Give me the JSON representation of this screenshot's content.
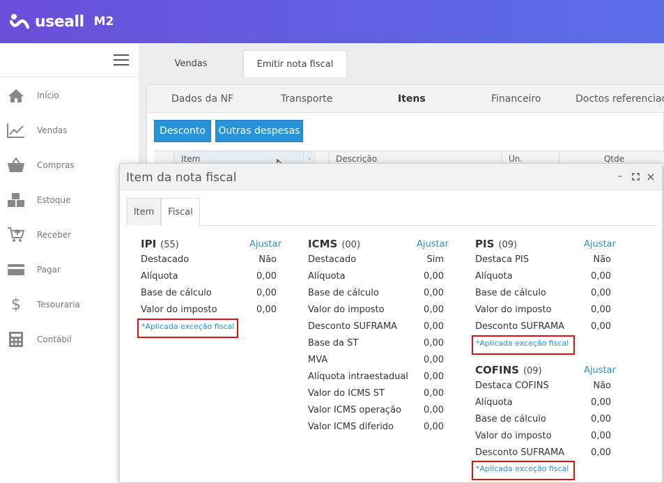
{
  "app": {
    "brand": "useall",
    "version": "M2"
  },
  "sidebar": {
    "items": [
      {
        "label": "Início",
        "icon": "home-icon"
      },
      {
        "label": "Vendas",
        "icon": "chart-line-icon"
      },
      {
        "label": "Compras",
        "icon": "basket-icon"
      },
      {
        "label": "Estoque",
        "icon": "boxes-icon"
      },
      {
        "label": "Receber",
        "icon": "cart-plus-icon"
      },
      {
        "label": "Pagar",
        "icon": "credit-card-icon"
      },
      {
        "label": "Tesouraria",
        "icon": "dollar-icon"
      },
      {
        "label": "Contábil",
        "icon": "calculator-icon"
      }
    ]
  },
  "top_tabs": [
    "Vendas",
    "Emitir nota fiscal"
  ],
  "sub_tabs": [
    "Dados da NF",
    "Transporte",
    "Itens",
    "Financeiro",
    "Doctos referenciados"
  ],
  "buttons": {
    "desconto": "Desconto",
    "outras": "Outras despesas"
  },
  "grid_headers": [
    "Item",
    "Descrição",
    "Un.",
    "Qtde"
  ],
  "modal": {
    "title": "Item da nota fiscal",
    "tabs": [
      "Item",
      "Fiscal"
    ],
    "ajustar": "Ajustar",
    "exception_text": "*Aplicada exceção fiscal",
    "ipi": {
      "title": "IPI",
      "code": "(55)",
      "rows": [
        {
          "label": "Destacado",
          "value": "Não"
        },
        {
          "label": "Alíquota",
          "value": "0,00"
        },
        {
          "label": "Base de cálculo",
          "value": "0,00"
        },
        {
          "label": "Valor do imposto",
          "value": "0,00"
        }
      ]
    },
    "icms": {
      "title": "ICMS",
      "code": "(00)",
      "rows": [
        {
          "label": "Destacado",
          "value": "Sim"
        },
        {
          "label": "Alíquota",
          "value": "0,00"
        },
        {
          "label": "Base de cálculo",
          "value": "0,00"
        },
        {
          "label": "Valor do imposto",
          "value": "0,00"
        },
        {
          "label": "Desconto SUFRAMA",
          "value": "0,00"
        },
        {
          "label": "Base da ST",
          "value": "0,00"
        },
        {
          "label": "MVA",
          "value": "0,00"
        },
        {
          "label": "Alíquota intraestadual",
          "value": "0,00"
        },
        {
          "label": "Valor do ICMS ST",
          "value": "0,00"
        },
        {
          "label": "Valor ICMS operação",
          "value": "0,00"
        },
        {
          "label": "Valor ICMS diferido",
          "value": "0,00"
        }
      ]
    },
    "pis": {
      "title": "PIS",
      "code": "(09)",
      "rows": [
        {
          "label": "Destaca PIS",
          "value": "Não"
        },
        {
          "label": "Alíquota",
          "value": "0,00"
        },
        {
          "label": "Base de cálculo",
          "value": "0,00"
        },
        {
          "label": "Valor do imposto",
          "value": "0,00"
        },
        {
          "label": "Desconto SUFRAMA",
          "value": "0,00"
        }
      ]
    },
    "cofins": {
      "title": "COFINS",
      "code": "(09)",
      "rows": [
        {
          "label": "Destaca COFINS",
          "value": "Não"
        },
        {
          "label": "Alíquota",
          "value": "0,00"
        },
        {
          "label": "Base de cálculo",
          "value": "0,00"
        },
        {
          "label": "Valor do imposto",
          "value": "0,00"
        },
        {
          "label": "Desconto SUFRAMA",
          "value": "0,00"
        }
      ]
    }
  },
  "colors": {
    "header_start": "#6a4fd8",
    "header_end": "#5a6ee8",
    "button": "#2793d9",
    "link": "#2e8ed6",
    "highlight_box": "#e01010"
  }
}
